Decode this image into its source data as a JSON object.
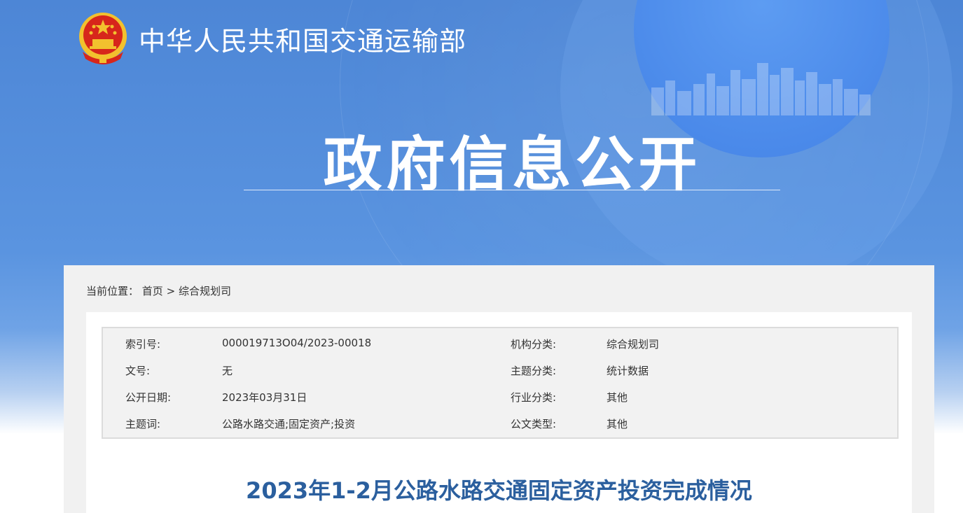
{
  "header": {
    "site_title": "中华人民共和国交通运输部",
    "section_title": "政府信息公开"
  },
  "breadcrumb": {
    "label": "当前位置：",
    "home": "首页",
    "separator": ">",
    "current": "综合规划司"
  },
  "meta": [
    {
      "label_left": "索引号:",
      "value_left": "000019713O04/2023-00018",
      "label_right": "机构分类:",
      "value_right": "综合规划司"
    },
    {
      "label_left": "文号:",
      "value_left": "无",
      "label_right": "主题分类:",
      "value_right": "统计数据"
    },
    {
      "label_left": "公开日期:",
      "value_left": "2023年03月31日",
      "label_right": "行业分类:",
      "value_right": "其他"
    },
    {
      "label_left": "主题词:",
      "value_left": "公路水路交通;固定资产;投资",
      "label_right": "公文类型:",
      "value_right": "其他"
    }
  ],
  "document": {
    "title": "2023年1-2月公路水路交通固定资产投资完成情况"
  },
  "colors": {
    "banner_blue": "#4d86d6",
    "title_blue": "#2b5f9e",
    "emblem_red": "#d7261b",
    "emblem_gold": "#f2c12e"
  }
}
